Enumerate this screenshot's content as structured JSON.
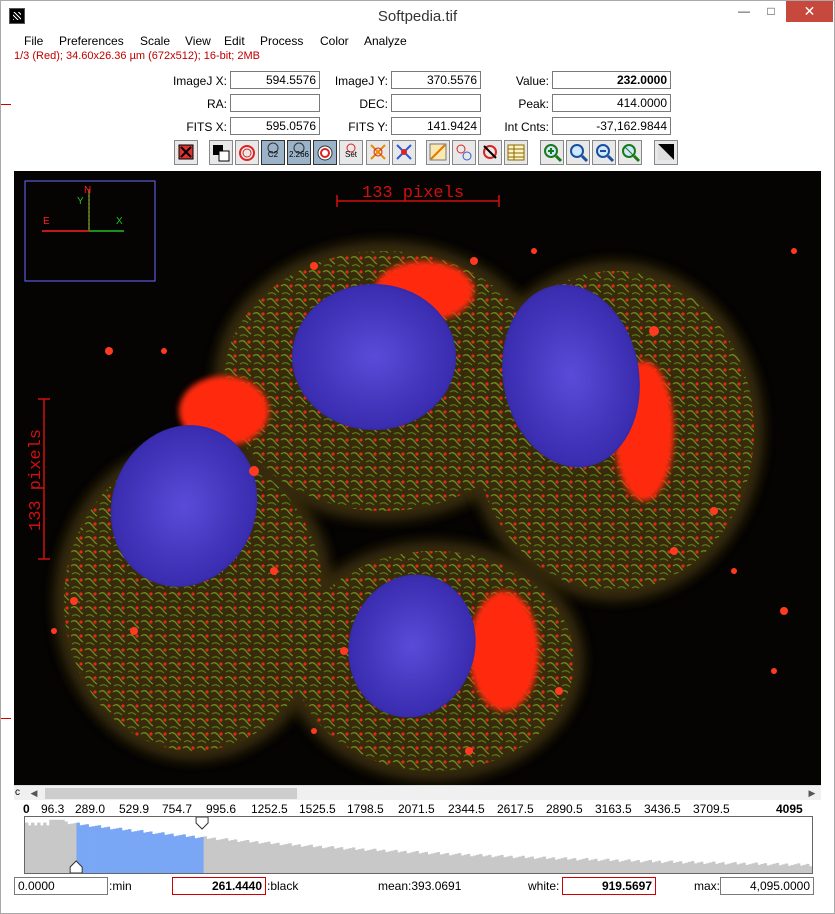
{
  "window": {
    "title": "Softpedia.tif",
    "min_glyph": "—",
    "max_glyph": "□",
    "close_glyph": "✕"
  },
  "menu": [
    "File",
    "Preferences",
    "Scale",
    "View",
    "Edit",
    "Process",
    "Color",
    "Analyze"
  ],
  "info_line": "1/3 (Red); 34.60x26.36 µm (672x512); 16-bit; 2MB",
  "coords": {
    "imagej_x_label": "ImageJ X:",
    "imagej_x": "594.5576",
    "imagej_y_label": "ImageJ Y:",
    "imagej_y": "370.5576",
    "value_label": "Value:",
    "value": "232.0000",
    "ra_label": "RA:",
    "ra": "",
    "dec_label": "DEC:",
    "dec": "",
    "peak_label": "Peak:",
    "peak": "414.0000",
    "fits_x_label": "FITS X:",
    "fits_x": "595.0576",
    "fits_y_label": "FITS Y:",
    "fits_y": "141.9424",
    "intcnts_label": "Int Cnts:",
    "intcnts": "-37,162.9844"
  },
  "toolbar": {
    "btn_c2": "C2",
    "btn_2266": "2.266",
    "btn_set": "Set"
  },
  "image": {
    "scale_bar_top": "133 pixels",
    "scale_bar_left": "133 pixels",
    "compass": {
      "n": "N",
      "y": "Y",
      "e": "E",
      "x": "X"
    }
  },
  "scroll": {
    "left_arrow": "◀",
    "right_arrow": "▶",
    "marker": "c"
  },
  "histogram": {
    "ticks": [
      "0",
      "96.3",
      "289.0",
      "529.9",
      "754.7",
      "995.6",
      "1252.5",
      "1525.5",
      "1798.5",
      "2071.5",
      "2344.5",
      "2617.5",
      "2890.5",
      "3163.5",
      "3436.5",
      "3709.5",
      "4095"
    ],
    "selected_fraction_start": 0.065,
    "selected_fraction_end": 0.225
  },
  "display_range": {
    "min_value": "0.0000",
    "min_label": ":min",
    "black_value": "261.4440",
    "black_label": ":black",
    "mean_label": "mean:393.0691",
    "white_label": "white:",
    "white_value": "919.5697",
    "max_label": "max:",
    "max_value": "4,095.0000"
  },
  "colors": {
    "accent_red": "#c00000",
    "histogram_selected": "#7aa7f5",
    "histogram_gray": "#c8c8c8",
    "compass_red": "#ff2020",
    "compass_green": "#20c020"
  }
}
